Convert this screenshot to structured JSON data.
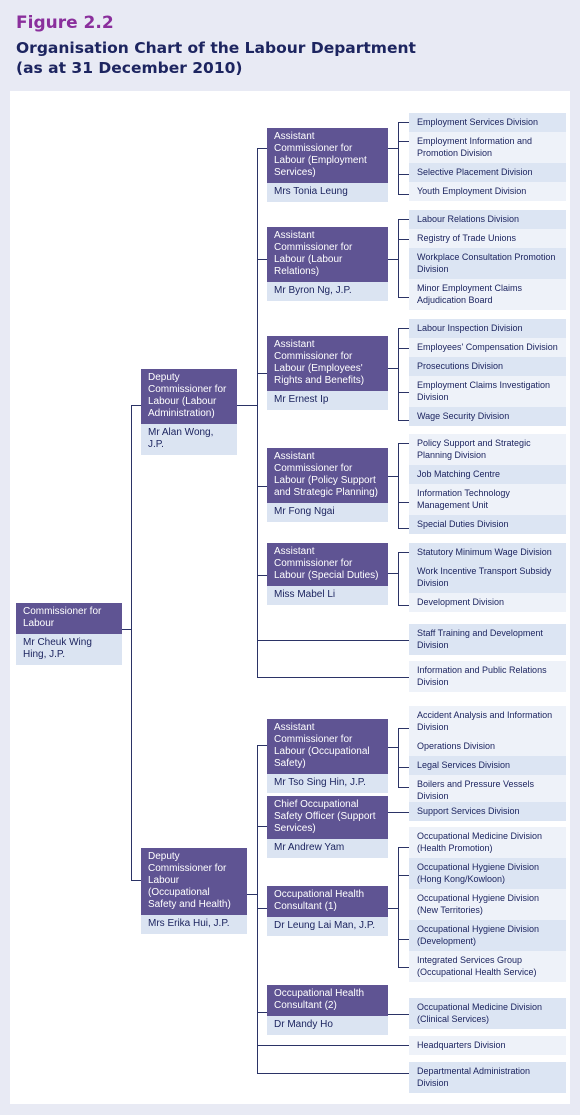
{
  "figure_label": "Figure 2.2",
  "title_line1": "Organisation Chart of the Labour Department",
  "title_line2": "(as at 31 December 2010)",
  "colors": {
    "post_header": "#5f5493",
    "post_name": "#dbe4f2",
    "division_alt": "#dce5f3",
    "division_plain": "#eef2f9",
    "connector": "#2b3366",
    "figure_label": "#8a2f9c",
    "title": "#1d2560"
  },
  "commissioner": {
    "title": "Commissioner for Labour",
    "name": "Mr Cheuk Wing Hing, J.P."
  },
  "deputies": [
    {
      "title": "Deputy Commissioner for Labour (Labour Administration)",
      "name": "Mr Alan Wong, J.P."
    },
    {
      "title": "Deputy Commissioner for Labour (Occupational Safety and Health)",
      "name": "Mrs Erika Hui, J.P."
    }
  ],
  "branches": [
    {
      "title": "Assistant Commissioner for Labour (Employment Services)",
      "name": "Mrs Tonia Leung",
      "divisions": [
        "Employment Services Division",
        "Employment Information and Promotion Division",
        "Selective Placement Division",
        "Youth Employment Division"
      ]
    },
    {
      "title": "Assistant Commissioner for Labour (Labour Relations)",
      "name": "Mr Byron Ng, J.P.",
      "divisions": [
        "Labour Relations Division",
        "Registry of Trade Unions",
        "Workplace Consultation Promotion Division",
        "Minor Employment Claims Adjudication Board"
      ]
    },
    {
      "title": "Assistant Commissioner for Labour (Employees' Rights and Benefits)",
      "name": "Mr Ernest Ip",
      "divisions": [
        "Labour Inspection Division",
        "Employees' Compensation Division",
        "Prosecutions Division",
        "Employment Claims Investigation Division",
        "Wage Security Division"
      ]
    },
    {
      "title": "Assistant Commissioner for Labour (Policy Support and Strategic Planning)",
      "name": "Mr Fong Ngai",
      "divisions": [
        "Policy Support and Strategic Planning Division",
        "Job Matching Centre",
        "Information Technology Management Unit",
        "Special Duties Division"
      ]
    },
    {
      "title": "Assistant Commissioner for Labour (Special Duties)",
      "name": "Miss Mabel Li",
      "divisions": [
        "Statutory Minimum Wage Division",
        "Work Incentive Transport Subsidy Division",
        "Development Division"
      ]
    },
    {
      "title": "Assistant Commissioner for Labour (Occupational Safety)",
      "name": "Mr Tso Sing Hin, J.P.",
      "divisions": [
        "Accident Analysis and Information Division",
        "Operations Division",
        "Legal Services Division",
        "Boilers and Pressure Vessels Division"
      ]
    },
    {
      "title": "Chief Occupational Safety Officer (Support Services)",
      "name": "Mr Andrew Yam",
      "divisions": [
        "Support Services Division"
      ]
    },
    {
      "title": "Occupational Health Consultant (1)",
      "name": "Dr Leung Lai Man, J.P.",
      "divisions": [
        "Occupational Medicine Division (Health Promotion)",
        "Occupational Hygiene Division (Hong Kong/Kowloon)",
        "Occupational Hygiene Division (New Territories)",
        "Occupational Hygiene Division (Development)",
        "Integrated Services Group (Occupational Health Service)"
      ]
    },
    {
      "title": "Occupational Health Consultant (2)",
      "name": "Dr Mandy Ho",
      "divisions": [
        "Occupational Medicine Division (Clinical Services)"
      ]
    }
  ],
  "direct_divisions_la": [
    "Staff Training and Development Division",
    "Information and Public Relations Division"
  ],
  "direct_divisions_osh": [
    "Headquarters Division",
    "Departmental Administration Division"
  ]
}
